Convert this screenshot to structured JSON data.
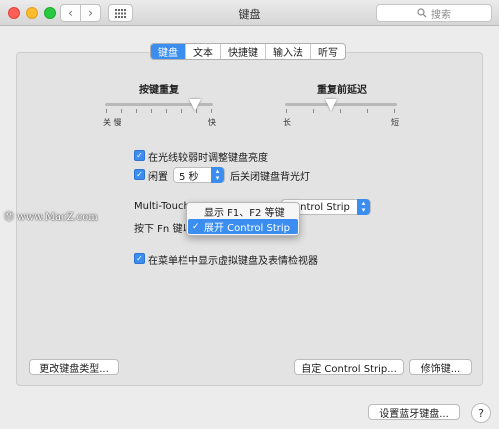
{
  "window": {
    "title": "键盘",
    "search_placeholder": "搜索",
    "back_glyph": "‹",
    "forward_glyph": "›"
  },
  "tabs": [
    {
      "label": "键盘",
      "active": true
    },
    {
      "label": "文本",
      "active": false
    },
    {
      "label": "快捷键",
      "active": false
    },
    {
      "label": "输入法",
      "active": false
    },
    {
      "label": "听写",
      "active": false
    }
  ],
  "key_repeat": {
    "title": "按键重复",
    "left_label": "关 慢",
    "right_label": "快",
    "level": 0.85
  },
  "delay_until_repeat": {
    "title": "重复前延迟",
    "left_label": "长",
    "right_label": "短",
    "level": 0.4
  },
  "options": {
    "adjust_brightness": {
      "checked": true,
      "label": "在光线较弱时调整键盘亮度"
    },
    "idle": {
      "checked": true,
      "label": "闲置",
      "value": "5 秒",
      "suffix": "后关闭键盘背光灯"
    },
    "touchbar_label": "Multi-Touch",
    "touchbar_value": "Control Strip",
    "fn_label": "按下 Fn 键以",
    "show_viewers": {
      "checked": true,
      "label": "在菜单栏中显示虚拟键盘及表情检视器"
    }
  },
  "dropdown_menu": {
    "items": [
      {
        "label": "显示 F1、F2 等键",
        "selected": false
      },
      {
        "label": "展开 Control Strip",
        "selected": true
      }
    ]
  },
  "buttons": {
    "change_keyboard_type": "更改键盘类型...",
    "customize_control_strip": "自定 Control Strip...",
    "modifier_keys": "修饰键...",
    "setup_bluetooth_keyboard": "设置蓝牙键盘...",
    "help": "?"
  },
  "watermark": "Ⓜ www.MacZ.com",
  "colors": {
    "accent": "#3b8ef0",
    "window_bg": "#ececec",
    "panel_bg": "#e3e3e3"
  }
}
